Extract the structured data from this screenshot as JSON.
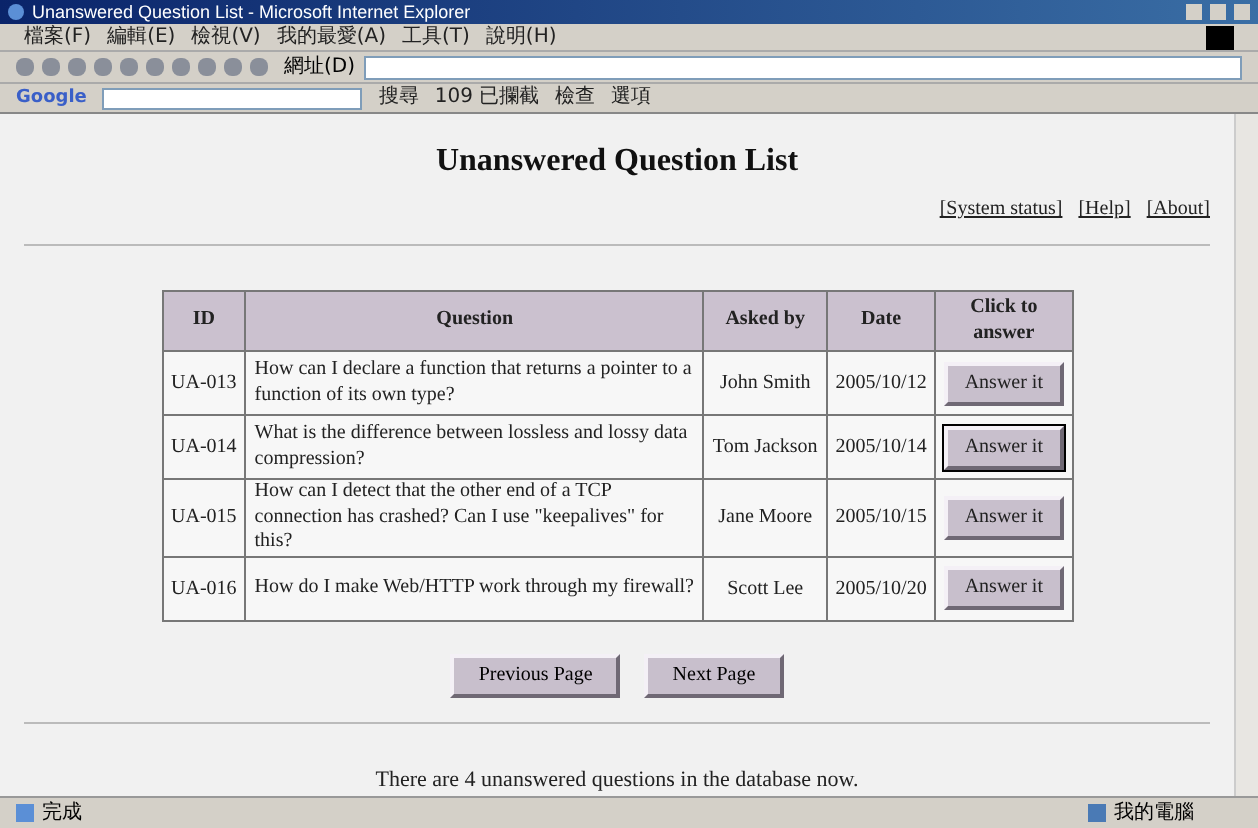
{
  "window": {
    "title": "Unanswered Question List - Microsoft Internet Explorer"
  },
  "menu": [
    "檔案(F)",
    "編輯(E)",
    "檢視(V)",
    "我的最愛(A)",
    "工具(T)",
    "說明(H)"
  ],
  "address": {
    "label": "網址(D)"
  },
  "google_toolbar": {
    "logo": "Google",
    "items": [
      "搜尋",
      "109 已攔截",
      "檢查",
      "選項"
    ]
  },
  "page": {
    "heading": "Unanswered Question List",
    "links": [
      "[System status]",
      "[Help]",
      "[About]"
    ],
    "table": {
      "columns": [
        "ID",
        "Question",
        "Asked by",
        "Date",
        "Click to answer"
      ],
      "rows": [
        {
          "id": "UA-013",
          "question": "How can I declare a function that returns a pointer to a function of its own type?",
          "asked_by": "John Smith",
          "date": "2005/10/12",
          "action": "Answer it",
          "focused": false
        },
        {
          "id": "UA-014",
          "question": "What is the difference between lossless and lossy data compression?",
          "asked_by": "Tom Jackson",
          "date": "2005/10/14",
          "action": "Answer it",
          "focused": true
        },
        {
          "id": "UA-015",
          "question": "How can I detect that the other end of a TCP connection has crashed? Can I use \"keepalives\" for this?",
          "asked_by": "Jane Moore",
          "date": "2005/10/15",
          "action": "Answer it",
          "focused": false
        },
        {
          "id": "UA-016",
          "question": "How do I make Web/HTTP work through my firewall?",
          "asked_by": "Scott Lee",
          "date": "2005/10/20",
          "action": "Answer it",
          "focused": false
        }
      ]
    },
    "pager": [
      "Previous Page",
      "Next Page"
    ],
    "footer": "There are 4 unanswered questions in the database now."
  },
  "status_bar": {
    "status": "完成",
    "zone": "我的電腦"
  }
}
